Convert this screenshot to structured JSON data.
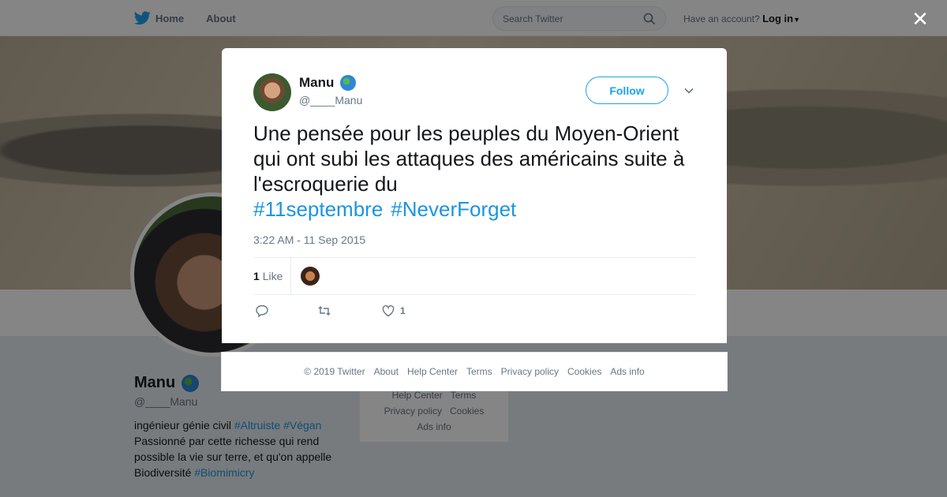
{
  "topbar": {
    "home_label": "Home",
    "about_label": "About",
    "search_placeholder": "Search Twitter",
    "account_prompt": "Have an account?",
    "login_label": "Log in"
  },
  "profile": {
    "name": "Manu",
    "handle": "@____Manu",
    "bio_line1_prefix": "ingénieur génie civil ",
    "bio_tag1": "#Altruiste",
    "bio_tag2": "#Végan",
    "bio_line2": "Passionné par cette richesse qui rend possible la vie sur terre, et qu'on appelle Biodiversité ",
    "bio_tag3": "#Biomimicry"
  },
  "side_footer": {
    "help_center": "Help Center",
    "terms": "Terms",
    "privacy": "Privacy policy",
    "cookies": "Cookies",
    "ads_info": "Ads info"
  },
  "tweet": {
    "author_name": "Manu",
    "author_handle": "@____Manu",
    "follow_label": "Follow",
    "text": "Une pensée pour les peuples du Moyen-Orient qui ont subi les attaques des américains suite à l'escroquerie du",
    "hashtags": [
      "#11septembre",
      "#NeverForget"
    ],
    "timestamp": "3:22 AM - 11 Sep 2015",
    "like_count": "1",
    "like_label": "Like",
    "action_like_count": "1"
  },
  "footer": {
    "copyright": "© 2019 Twitter",
    "links": [
      "About",
      "Help Center",
      "Terms",
      "Privacy policy",
      "Cookies",
      "Ads info"
    ]
  },
  "colors": {
    "accent": "#1da1f2",
    "link": "#1b95e0",
    "muted": "#657786",
    "overlay": "rgba(0,0,0,0.48)"
  },
  "icons": [
    "twitter-bird-icon",
    "search-icon",
    "caret-down-icon",
    "close-icon",
    "globe-emoji-icon",
    "chevron-down-icon",
    "reply-icon",
    "retweet-icon",
    "heart-icon"
  ]
}
